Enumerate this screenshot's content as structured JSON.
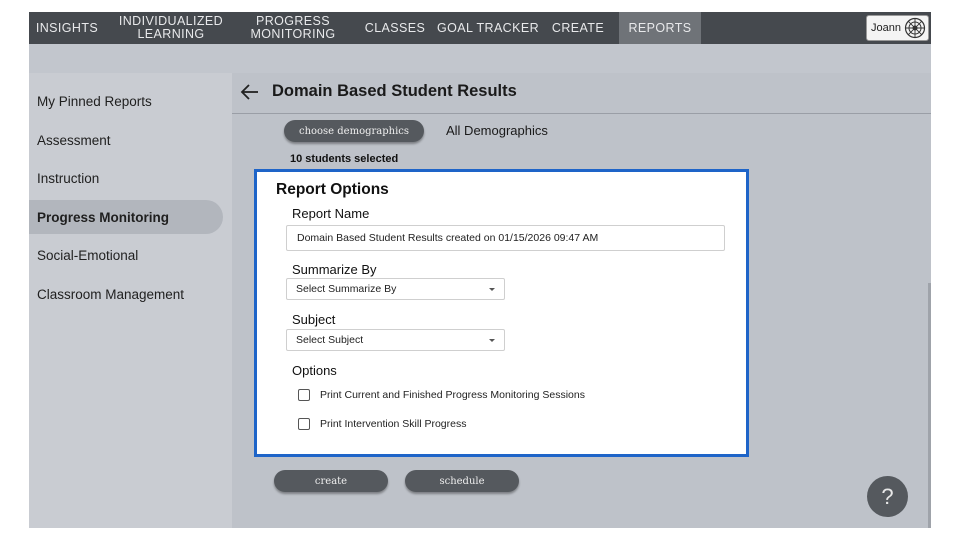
{
  "nav": {
    "items": [
      {
        "label": "INSIGHTS"
      },
      {
        "label": "INDIVIDUALIZED\nLEARNING"
      },
      {
        "label": "PROGRESS\nMONITORING"
      },
      {
        "label": "CLASSES"
      },
      {
        "label": "GOAL TRACKER"
      },
      {
        "label": "CREATE"
      },
      {
        "label": "REPORTS"
      }
    ],
    "active": "REPORTS",
    "user_name": "Joann"
  },
  "sidebar": {
    "items": [
      {
        "label": "My Pinned Reports"
      },
      {
        "label": "Assessment"
      },
      {
        "label": "Instruction"
      },
      {
        "label": "Progress Monitoring"
      },
      {
        "label": "Social-Emotional"
      },
      {
        "label": "Classroom Management"
      }
    ],
    "active": "Progress Monitoring"
  },
  "main": {
    "title": "Domain Based Student Results",
    "demographics_button": "choose demographics",
    "demographics_value": "All Demographics",
    "selected_count": "10 students selected"
  },
  "report_options": {
    "title": "Report Options",
    "report_name_label": "Report Name",
    "report_name_value": "Domain Based Student Results created on 01/15/2026 09:47 AM",
    "summarize_label": "Summarize By",
    "summarize_placeholder": "Select Summarize By",
    "subject_label": "Subject",
    "subject_placeholder": "Select Subject",
    "options_label": "Options",
    "checkboxes": [
      {
        "label": "Print Current and Finished Progress Monitoring Sessions",
        "checked": false
      },
      {
        "label": "Print Intervention Skill Progress",
        "checked": false
      }
    ]
  },
  "actions": {
    "create": "create",
    "schedule": "schedule",
    "help": "?"
  },
  "colors": {
    "nav_bg": "#45494e",
    "active_nav": "#6f7378",
    "panel_border": "#1e64c8",
    "button_bg": "#55595e"
  }
}
